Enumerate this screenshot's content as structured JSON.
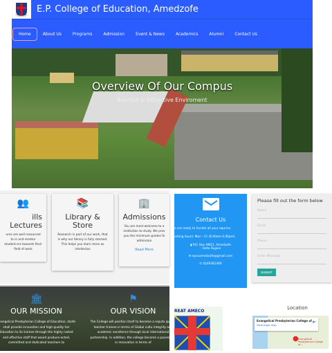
{
  "header": {
    "title": "E.P. College of Education, Amedzofe"
  },
  "nav": {
    "items": [
      "Home",
      "About Us",
      "Programs",
      "Admission",
      "Event & News",
      "Academics",
      "Alumni",
      "Contact Us"
    ]
  },
  "hero": {
    "title": "Overview Of Our Compus",
    "subtitle": "Beutiful & Attrective Enviroment"
  },
  "cards": [
    {
      "title": "ills Lectures",
      "text": "ures are well resourced to in and mentor student-ers towards their field of work"
    },
    {
      "title": "Library & Store",
      "text": "Research in part of our work, that is why our library is fully stocked. This helps you learn more as intellectus"
    },
    {
      "title": "Admissions",
      "text": "You are most welcome to o institution to study. We prov you the minimum grades fo admission",
      "link": "Read More"
    }
  ],
  "contact": {
    "title": "Contact Us",
    "line1": "e are ready to handel all your equries.",
    "line2": "orking hours: Mon - Fri (8.00am-4.00pm)",
    "address1": "P.O. Box AM12, Amedzofe",
    "address2": "- Volta Region",
    "email": "epcoamedzofe@gmail.com",
    "phone": "0249381406"
  },
  "form": {
    "heading": "Please fill out the form below",
    "name": "Name",
    "email": "Email",
    "phone": "Phone",
    "message": "Enter Message",
    "submit": "SUBMIT"
  },
  "mission": {
    "title": "OUR MISSION",
    "text": "Evangelical Presbyterian College of Education, dzofe shall provide innovation and high quality her Education to its trainee through the highly ivated and effective staff that would produce-ected, committed and dedicated teachers to"
  },
  "vision": {
    "title": "OUR VISION",
    "text": "The College will position itself to become a reputa quality teacher trainee in terms of Global cultu integrity and academic excellence through local international partnership. In addition, the college become a pacesetter in innovation in terms of"
  },
  "ameco": {
    "banner": "REAT AMECO"
  },
  "location": {
    "title": "Location",
    "map_place": "Evangelical Presbyterian College of ...",
    "map_link": "View larger map",
    "pin_label": "Evangelical Presbyterian College of..."
  }
}
